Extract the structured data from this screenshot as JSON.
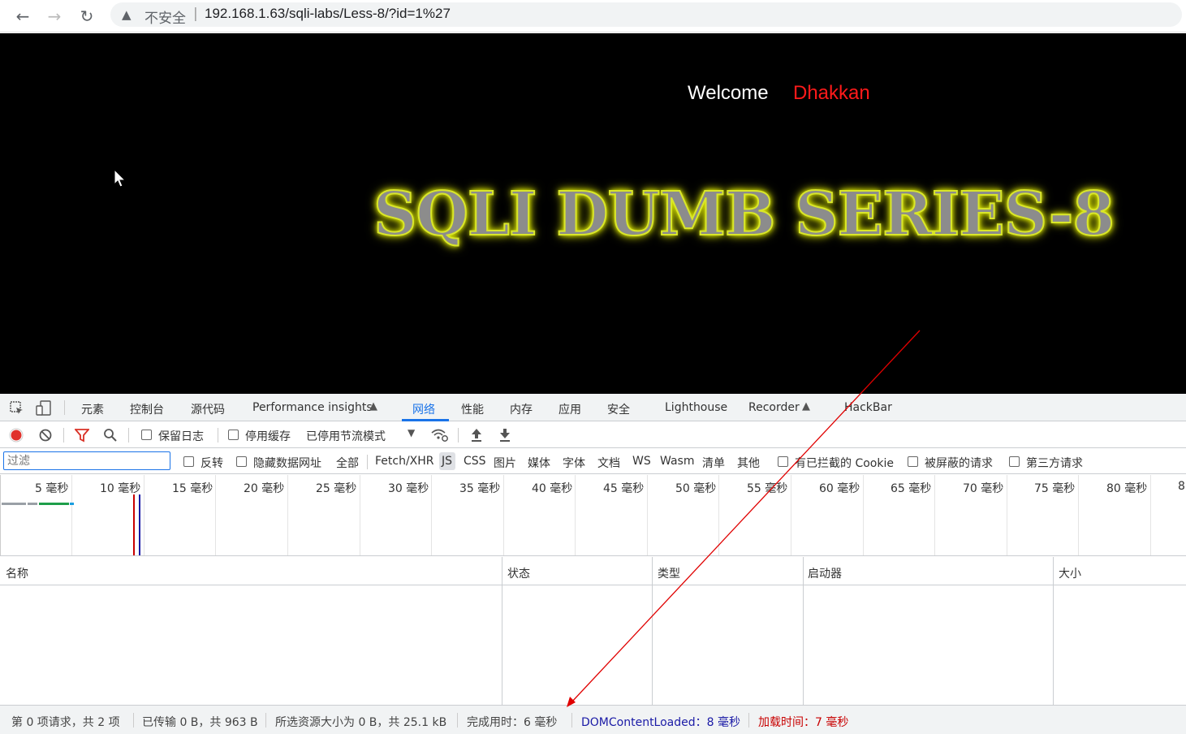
{
  "browser": {
    "insecure_label": "不安全",
    "separator": "|",
    "url": "192.168.1.63/sqli-labs/Less-8/?id=1%27"
  },
  "page": {
    "welcome": "Welcome",
    "username": "Dhakkan",
    "banner": "SQLI DUMB SERIES-8"
  },
  "devtools": {
    "tabs": [
      "元素",
      "控制台",
      "源代码",
      "Performance insights",
      "网络",
      "性能",
      "内存",
      "应用",
      "安全",
      "Lighthouse",
      "Recorder",
      "HackBar"
    ],
    "active_tab": "网络",
    "toolbar": {
      "preserve_log": "保留日志",
      "disable_cache": "停用缓存",
      "throttle": "已停用节流模式"
    },
    "filter": {
      "placeholder": "过滤",
      "invert": "反转",
      "hide_data_urls": "隐藏数据网址",
      "types": [
        "全部",
        "Fetch/XHR",
        "JS",
        "CSS",
        "图片",
        "媒体",
        "字体",
        "文档",
        "WS",
        "Wasm",
        "清单",
        "其他"
      ],
      "blocked_cookies": "有已拦截的 Cookie",
      "blocked_requests": "被屏蔽的请求",
      "third_party": "第三方请求"
    },
    "timeline_ticks": [
      "5 毫秒",
      "10 毫秒",
      "15 毫秒",
      "20 毫秒",
      "25 毫秒",
      "30 毫秒",
      "35 毫秒",
      "40 毫秒",
      "45 毫秒",
      "50 毫秒",
      "55 毫秒",
      "60 毫秒",
      "65 毫秒",
      "70 毫秒",
      "75 毫秒",
      "80 毫秒",
      "8"
    ],
    "columns": [
      "名称",
      "状态",
      "类型",
      "启动器",
      "大小"
    ],
    "status": {
      "requests": "第 0 项请求，共 2 项",
      "transferred": "已传输 0 B，共 963 B",
      "resources": "所选资源大小为 0 B，共 25.1 kB",
      "finish": "完成用时：6 毫秒",
      "dcl": "DOMContentLoaded：8 毫秒",
      "load": "加载时间：7 毫秒"
    }
  },
  "colors": {
    "accent": "#1a73e8",
    "username": "#ff1a1a",
    "dcl": "#1a1aa6",
    "load": "#c80000",
    "annotation_arrow": "#e00000"
  }
}
